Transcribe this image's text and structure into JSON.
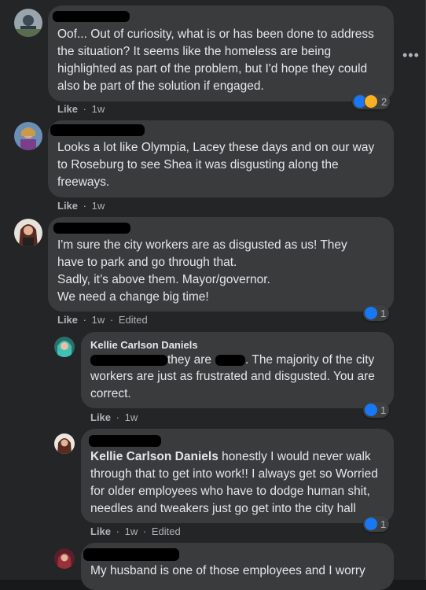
{
  "comments": [
    {
      "lines": [
        "Oof... Out of curiosity, what is or has been done to address",
        "the situation? It seems like the homeless are being",
        "highlighted as part of the problem, but I'd hope they could",
        "also be part of the solution if engaged."
      ],
      "like": "Like",
      "time": "1w",
      "reaction_count": "2"
    },
    {
      "lines": [
        "Looks a lot like Olympia, Lacey these days and on our way",
        "to Roseburg to see Shea it was disgusting along the",
        "freeways."
      ],
      "like": "Like",
      "time": "1w"
    },
    {
      "lines": [
        "I'm sure the city workers are as disgusted as us! They",
        "have to park and go through that.",
        "Sadly, it’s above them. Mayor/governor.",
        "We need a change big time!"
      ],
      "like": "Like",
      "time": "1w",
      "edited": "Edited",
      "reaction_count": "1"
    },
    {
      "author": "Kellie Carlson Daniels",
      "line1_mid": "they are",
      "line1_end": ". The majority of the city",
      "lines": [
        "workers are just as frustrated and disgusted. You are",
        "correct."
      ],
      "like": "Like",
      "time": "1w",
      "reaction_count": "1"
    },
    {
      "mention": "Kellie Carlson Daniels",
      "line1_rest": " honestly I would never walk",
      "lines": [
        "through that to get into work!! I always get so Worried",
        "for older employees who have to dodge human shit,",
        "needles and tweakers just go get into the city hall"
      ],
      "like": "Like",
      "time": "1w",
      "edited": "Edited",
      "reaction_count": "1"
    },
    {
      "lines": [
        "My husband is one of those employees and I worry"
      ]
    }
  ],
  "separator": "·",
  "more_label": "•••"
}
